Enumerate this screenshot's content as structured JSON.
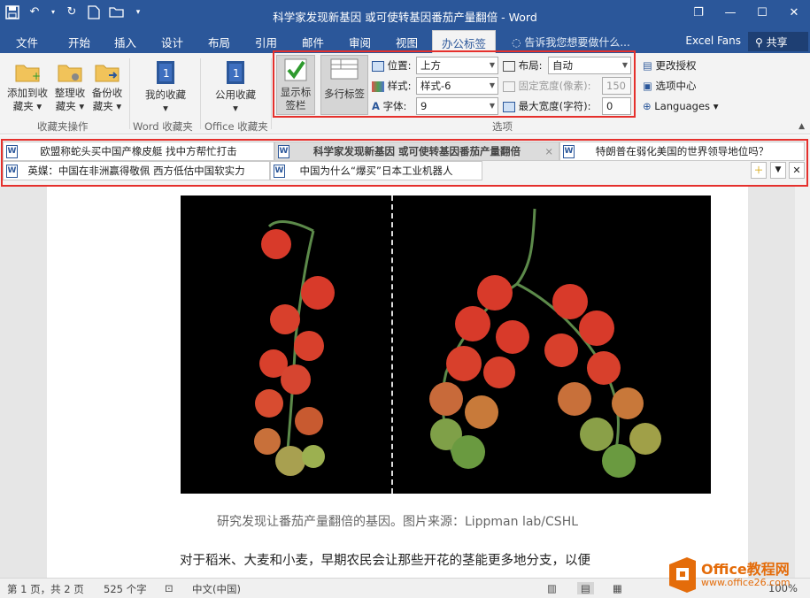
{
  "window": {
    "title": "科学家发现新基因 或可使转基因番茄产量翻倍 - Word",
    "controls": {
      "restore": "❐",
      "minimize": "—",
      "maximize": "☐",
      "close": "✕"
    }
  },
  "menu": {
    "tabs": [
      "文件",
      "开始",
      "插入",
      "设计",
      "布局",
      "引用",
      "邮件",
      "审阅",
      "视图",
      "办公标签"
    ],
    "active_tab": "办公标签",
    "tell_me": "告诉我您想要做什么...",
    "user": "Excel Fans",
    "share": "共享"
  },
  "ribbon": {
    "fav_group": {
      "label": "收藏夹操作",
      "add": "添加到收藏夹",
      "organize": "整理收藏夹",
      "backup": "备份收藏夹"
    },
    "word_fav_group": {
      "label": "Word 收藏夹",
      "my_fav": "我的收藏"
    },
    "office_fav_group": {
      "label": "Office 收藏夹",
      "public_fav": "公用收藏"
    },
    "options_group": {
      "label": "选项",
      "show_tabs": "显示标签栏",
      "multi_row": "多行标签",
      "position_label": "位置:",
      "position_value": "上方",
      "style_label": "样式:",
      "style_value": "样式-6",
      "font_label": "字体:",
      "font_value": "9",
      "layout_label": "布局:",
      "layout_value": "自动",
      "fixed_width_label": "固定宽度(像素):",
      "fixed_width_value": "150",
      "max_width_label": "最大宽度(字符):",
      "max_width_value": "0"
    },
    "extra": {
      "license": "更改授权",
      "options_center": "选项中心",
      "languages": "Languages"
    }
  },
  "doc_tabs": {
    "row1": [
      {
        "title": "欧盟称蛇头买中国产橡皮艇 找中方帮忙打击",
        "active": false
      },
      {
        "title": "科学家发现新基因 或可使转基因番茄产量翻倍",
        "active": true
      },
      {
        "title": "特朗普在弱化美国的世界领导地位吗？",
        "active": false
      }
    ],
    "row2": [
      {
        "title": "英媒：中国在非洲赢得敬佩 西方低估中国软实力",
        "active": false
      },
      {
        "title": "中国为什么“爆买”日本工业机器人",
        "active": false
      }
    ],
    "tab_close": "×",
    "new_doc": "＋",
    "dropdown": "▼",
    "close_all": "✕"
  },
  "document": {
    "caption": "研究发现让番茄产量翻倍的基因。图片来源：Lippman lab/CSHL",
    "paragraph": "对于稻米、大麦和小麦，早期农民会让那些开花的茎能更多地分支，以便"
  },
  "status": {
    "page": "第 1 页，共 2 页",
    "words": "525 个字",
    "language": "中文(中国)",
    "zoom": "100%"
  },
  "watermark": {
    "brand": "Office教程网",
    "url": "www.office26.com"
  },
  "colors": {
    "word_blue": "#2b579a",
    "highlight_red": "#e5302c",
    "orange": "#e46c0a"
  }
}
